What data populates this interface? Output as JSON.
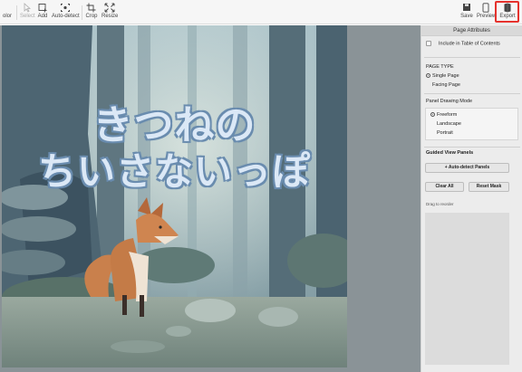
{
  "toolbar": {
    "left_items": [
      {
        "label": "olor",
        "icon": "color-icon",
        "enabled": true
      },
      {
        "label": "Select",
        "icon": "cursor-icon",
        "enabled": false
      },
      {
        "label": "Add",
        "icon": "add-frame-icon",
        "enabled": true
      },
      {
        "label": "Auto-detect",
        "icon": "auto-detect-icon",
        "enabled": true
      },
      {
        "label": "Crop",
        "icon": "crop-icon",
        "enabled": true
      },
      {
        "label": "Resize",
        "icon": "resize-icon",
        "enabled": true
      }
    ],
    "right_items": [
      {
        "label": "Save",
        "icon": "save-icon"
      },
      {
        "label": "Preview",
        "icon": "preview-icon"
      },
      {
        "label": "Export",
        "icon": "export-icon",
        "highlighted": true
      }
    ],
    "highlight_color": "#e5322d"
  },
  "page": {
    "title_line_1": "きつねの",
    "title_line_2": "ちいさないっぽ"
  },
  "sidebar": {
    "header": "Page Attributes",
    "include_toc": {
      "label": "Include in Table of Contents",
      "checked": false
    },
    "page_type": {
      "heading": "PAGE TYPE",
      "options": [
        {
          "label": "Single Page",
          "selected": true
        },
        {
          "label": "Facing Page",
          "selected": false
        }
      ]
    },
    "drawing_mode": {
      "heading": "Panel Drawing Mode",
      "options": [
        {
          "label": "Freeform",
          "selected": true
        },
        {
          "label": "Landscape",
          "selected": false
        },
        {
          "label": "Portrait",
          "selected": false
        }
      ]
    },
    "guided": {
      "heading": "Guided View Panels",
      "auto_detect_label": "Auto-detect Panels",
      "auto_detect_icon": "plus-icon",
      "clear_all_label": "Clear All",
      "reset_mask_label": "Reset Mask",
      "drag_hint": "Drag to reorder"
    }
  }
}
